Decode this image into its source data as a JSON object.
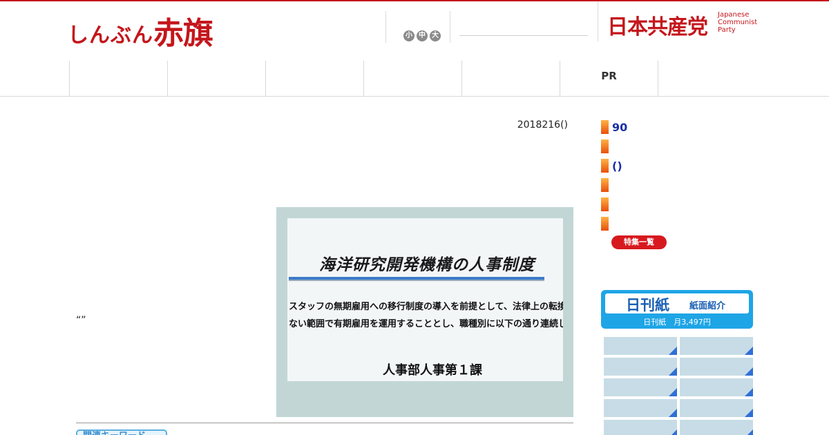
{
  "header": {
    "logo_small": "しんぶん",
    "logo_big": "赤旗",
    "font_sizes": [
      "小",
      "中",
      "大"
    ],
    "party_kanji": "日本共産党",
    "party_english": [
      "Japanese",
      "Communist",
      "Party"
    ]
  },
  "nav": {
    "items": [
      "",
      "",
      "",
      "",
      "",
      "PR",
      ""
    ]
  },
  "article": {
    "date": "2018216()",
    "quote": "“”",
    "photo": {
      "title": "海洋研究開発機構の人事制度",
      "lines": [
        "スタッフの無期雇用への移行制度の導入を前提として、法律上の転換権を発生させ",
        "ない範囲で有期雇用を運用することとし、職種別に以下の通り連続した雇用を制限し"
      ],
      "department": "人事部人事第１課"
    },
    "keyword_label": "関連キーワード"
  },
  "sidebar": {
    "items": [
      "90",
      "",
      "()",
      "",
      "",
      ""
    ],
    "feature_list_label": "特集一覧",
    "nikkan": {
      "title": "日刊紙",
      "subtitle": "紙面紹介",
      "price": "日刊紙　月3,497円"
    }
  },
  "colors": {
    "brand_red": "#c4161c",
    "link_blue": "#1a2fa6",
    "nikkan_blue": "#1ea5e6"
  }
}
